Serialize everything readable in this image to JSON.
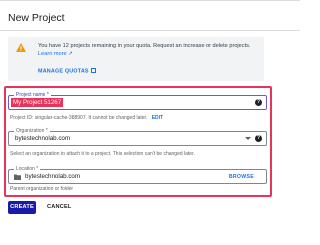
{
  "header": {
    "title": "New Project"
  },
  "quota": {
    "message": "You have 12 projects remaining in your quota. Request an increase or delete projects.",
    "learn_more": "Learn more",
    "manage_label": "MANAGE QUOTAS",
    "warning_color": "#f29900"
  },
  "form": {
    "project_name": {
      "label": "Project name *",
      "value": "My Project 51267"
    },
    "project_id": {
      "prefix": "Project ID:",
      "value": "singular-cache-388907.",
      "suffix": "It cannot be changed later.",
      "edit_label": "EDIT"
    },
    "organization": {
      "label": "Organization *",
      "value": "bytestechnolab.com",
      "helper": "Select an organization to attach it to a project. This selection can't be changed later."
    },
    "location": {
      "label": "Location *",
      "value": "bytestechnolab.com",
      "browse_label": "BROWSE",
      "helper": "Parent organization or folder"
    },
    "help_glyph": "?"
  },
  "actions": {
    "create_label": "CREATE",
    "cancel_label": "CANCEL"
  },
  "colors": {
    "accent": "#1a73e8",
    "primary_button": "#1a1aaa",
    "highlight": "#e8335a"
  }
}
